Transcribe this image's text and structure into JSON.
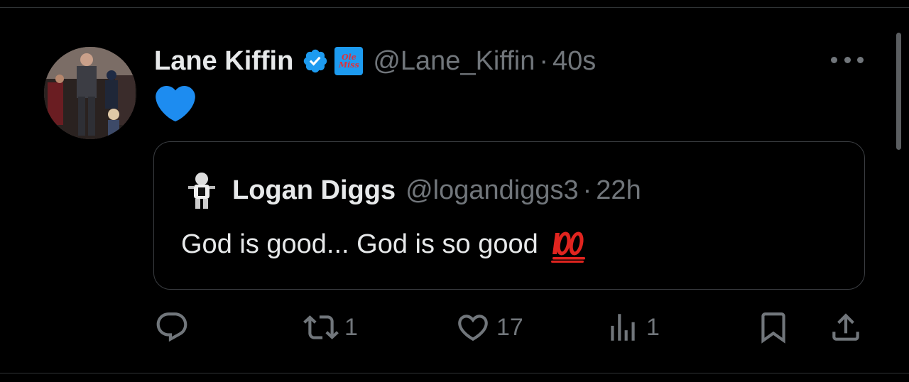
{
  "tweet": {
    "author_name": "Lane Kiffin",
    "handle": "@Lane_Kiffin",
    "separator": "·",
    "time": "40s",
    "affiliate_badge_text": "Ole Miss",
    "body_emoji": "blue-heart",
    "verified_color": "#1d9bf0"
  },
  "quoted": {
    "author_name": "Logan Diggs",
    "handle": "@logandiggs3",
    "separator": "·",
    "time": "22h",
    "text": "God is good... God is so good",
    "emoji": "hundred-points"
  },
  "actions": {
    "reply_count": "",
    "repost_count": "1",
    "like_count": "17",
    "views_count": "1"
  },
  "colors": {
    "background": "#000000",
    "text_primary": "#e7e9ea",
    "text_secondary": "#71767b",
    "accent": "#1d9bf0",
    "border": "#2f3336"
  }
}
